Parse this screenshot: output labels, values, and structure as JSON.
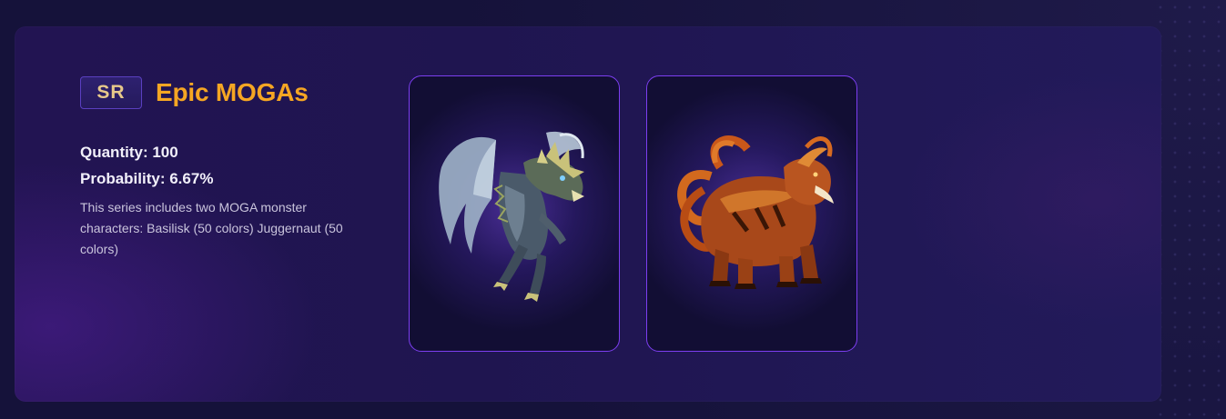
{
  "series": {
    "rarity_badge": "SR",
    "title": "Epic MOGAs",
    "quantity": "Quantity: 100",
    "probability": "Probability: 6.67%",
    "description": "This series includes two MOGA monster characters: Basilisk (50 colors) Juggernaut (50 colors)"
  },
  "cards": [
    {
      "icon": "basilisk-monster-image"
    },
    {
      "icon": "juggernaut-monster-image"
    }
  ],
  "colors": {
    "title": "#f5a623",
    "badge_text": "#e7c98a",
    "card_border": "#7c3ef0",
    "panel": "#221452",
    "background": "#15123a"
  }
}
